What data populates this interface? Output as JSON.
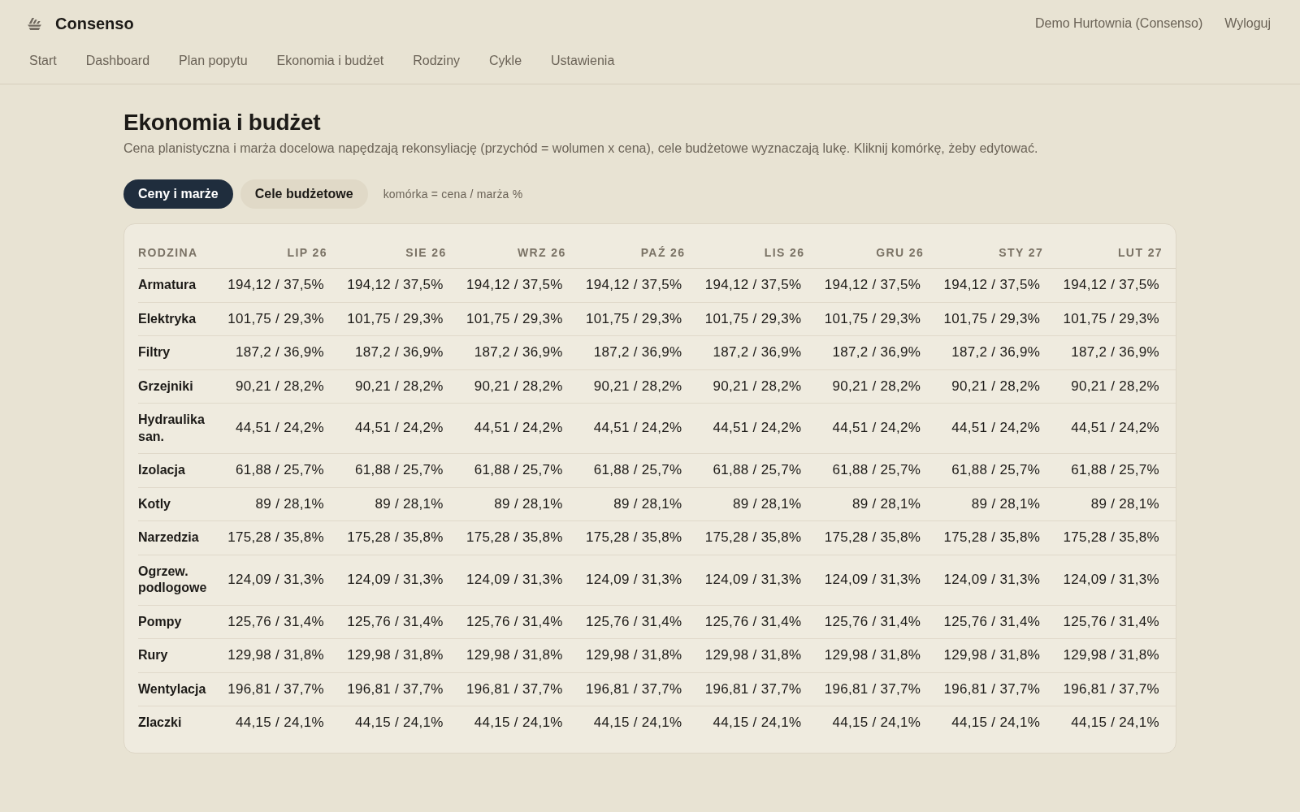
{
  "header": {
    "brand": "Consenso",
    "nav": [
      "Start",
      "Dashboard",
      "Plan popytu",
      "Ekonomia i budżet",
      "Rodziny",
      "Cykle",
      "Ustawienia"
    ],
    "account": "Demo Hurtownia (Consenso)",
    "logout": "Wyloguj"
  },
  "page": {
    "title": "Ekonomia i budżet",
    "subtitle": "Cena planistyczna i marża docelowa napędzają rekonsyliację (przychód = wolumen x cena), cele budżetowe wyznaczają lukę. Kliknij komórkę, żeby edytować."
  },
  "tabs": [
    {
      "label": "Ceny i marże",
      "selected": true
    },
    {
      "label": "Cele budżetowe",
      "selected": false
    }
  ],
  "legend": "komórka = cena / marża %",
  "table": {
    "columns": [
      "RODZINA",
      "LIP 26",
      "SIE 26",
      "WRZ 26",
      "PAŹ 26",
      "LIS 26",
      "GRU 26",
      "STY 27",
      "LUT 27"
    ],
    "rows": [
      {
        "cells": [
          "Armatura",
          "194,12 / 37,5%",
          "194,12 / 37,5%",
          "194,12 / 37,5%",
          "194,12 / 37,5%",
          "194,12 / 37,5%",
          "194,12 / 37,5%",
          "194,12 / 37,5%",
          "194,12 / 37,5%"
        ]
      },
      {
        "cells": [
          "Elektryka",
          "101,75 / 29,3%",
          "101,75 / 29,3%",
          "101,75 / 29,3%",
          "101,75 / 29,3%",
          "101,75 / 29,3%",
          "101,75 / 29,3%",
          "101,75 / 29,3%",
          "101,75 / 29,3%"
        ]
      },
      {
        "cells": [
          "Filtry",
          "187,2 / 36,9%",
          "187,2 / 36,9%",
          "187,2 / 36,9%",
          "187,2 / 36,9%",
          "187,2 / 36,9%",
          "187,2 / 36,9%",
          "187,2 / 36,9%",
          "187,2 / 36,9%"
        ]
      },
      {
        "cells": [
          "Grzejniki",
          "90,21 / 28,2%",
          "90,21 / 28,2%",
          "90,21 / 28,2%",
          "90,21 / 28,2%",
          "90,21 / 28,2%",
          "90,21 / 28,2%",
          "90,21 / 28,2%",
          "90,21 / 28,2%"
        ]
      },
      {
        "cells": [
          "Hydraulika san.",
          "44,51 / 24,2%",
          "44,51 / 24,2%",
          "44,51 / 24,2%",
          "44,51 / 24,2%",
          "44,51 / 24,2%",
          "44,51 / 24,2%",
          "44,51 / 24,2%",
          "44,51 / 24,2%"
        ]
      },
      {
        "cells": [
          "Izolacja",
          "61,88 / 25,7%",
          "61,88 / 25,7%",
          "61,88 / 25,7%",
          "61,88 / 25,7%",
          "61,88 / 25,7%",
          "61,88 / 25,7%",
          "61,88 / 25,7%",
          "61,88 / 25,7%"
        ]
      },
      {
        "cells": [
          "Kotly",
          "89 / 28,1%",
          "89 / 28,1%",
          "89 / 28,1%",
          "89 / 28,1%",
          "89 / 28,1%",
          "89 / 28,1%",
          "89 / 28,1%",
          "89 / 28,1%"
        ]
      },
      {
        "cells": [
          "Narzedzia",
          "175,28 / 35,8%",
          "175,28 / 35,8%",
          "175,28 / 35,8%",
          "175,28 / 35,8%",
          "175,28 / 35,8%",
          "175,28 / 35,8%",
          "175,28 / 35,8%",
          "175,28 / 35,8%"
        ]
      },
      {
        "cells": [
          "Ogrzew. podlogowe",
          "124,09 / 31,3%",
          "124,09 / 31,3%",
          "124,09 / 31,3%",
          "124,09 / 31,3%",
          "124,09 / 31,3%",
          "124,09 / 31,3%",
          "124,09 / 31,3%",
          "124,09 / 31,3%"
        ]
      },
      {
        "cells": [
          "Pompy",
          "125,76 / 31,4%",
          "125,76 / 31,4%",
          "125,76 / 31,4%",
          "125,76 / 31,4%",
          "125,76 / 31,4%",
          "125,76 / 31,4%",
          "125,76 / 31,4%",
          "125,76 / 31,4%"
        ]
      },
      {
        "cells": [
          "Rury",
          "129,98 / 31,8%",
          "129,98 / 31,8%",
          "129,98 / 31,8%",
          "129,98 / 31,8%",
          "129,98 / 31,8%",
          "129,98 / 31,8%",
          "129,98 / 31,8%",
          "129,98 / 31,8%"
        ]
      },
      {
        "cells": [
          "Wentylacja",
          "196,81 / 37,7%",
          "196,81 / 37,7%",
          "196,81 / 37,7%",
          "196,81 / 37,7%",
          "196,81 / 37,7%",
          "196,81 / 37,7%",
          "196,81 / 37,7%",
          "196,81 / 37,7%"
        ]
      },
      {
        "cells": [
          "Zlaczki",
          "44,15 / 24,1%",
          "44,15 / 24,1%",
          "44,15 / 24,1%",
          "44,15 / 24,1%",
          "44,15 / 24,1%",
          "44,15 / 24,1%",
          "44,15 / 24,1%",
          "44,15 / 24,1%"
        ]
      }
    ]
  }
}
